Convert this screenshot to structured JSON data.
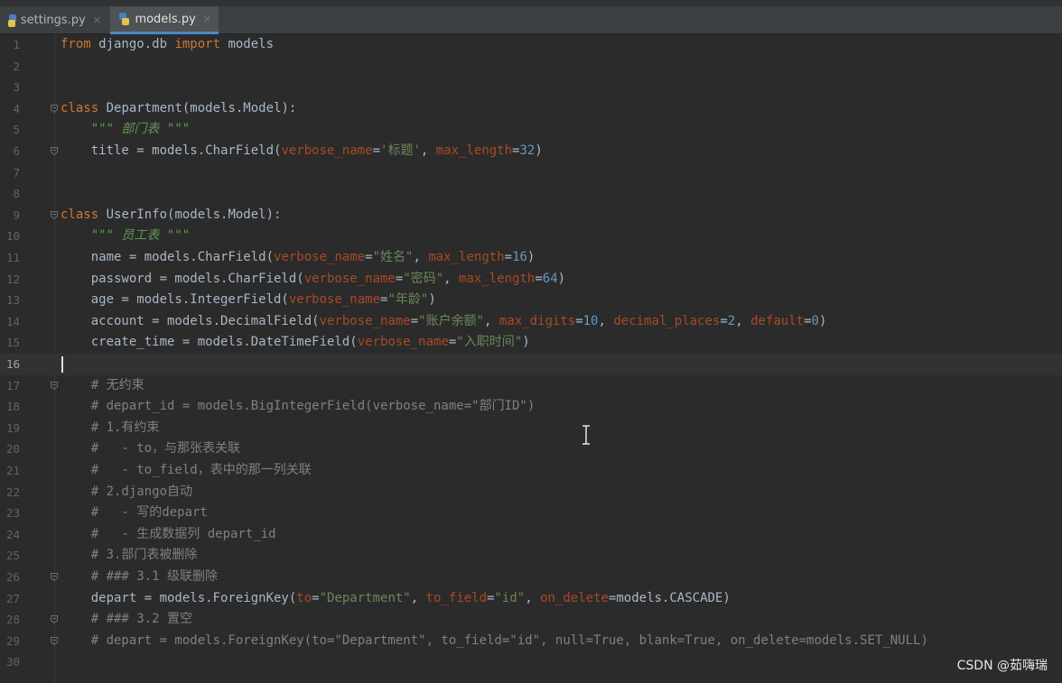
{
  "tabs": [
    {
      "label": "settings.py",
      "active": false
    },
    {
      "label": "models.py",
      "active": true
    }
  ],
  "editor": {
    "current_line": 16,
    "lines": [
      {
        "n": "1",
        "tokens": [
          [
            "kw",
            "from"
          ],
          [
            "t",
            " django.db "
          ],
          [
            "kw",
            "import"
          ],
          [
            "t",
            " models"
          ]
        ]
      },
      {
        "n": "2",
        "tokens": []
      },
      {
        "n": "3",
        "tokens": []
      },
      {
        "n": "4",
        "fold": true,
        "tokens": [
          [
            "kw",
            "class"
          ],
          [
            "t",
            " Department(models.Model):"
          ]
        ]
      },
      {
        "n": "5",
        "tokens": [
          [
            "t",
            "    "
          ],
          [
            "doc",
            "\"\"\" 部门表 \"\"\""
          ]
        ]
      },
      {
        "n": "6",
        "fold": true,
        "tokens": [
          [
            "t",
            "    title = models.CharField("
          ],
          [
            "prm",
            "verbose_name"
          ],
          [
            "t",
            "="
          ],
          [
            "str",
            "'标题'"
          ],
          [
            "t",
            ", "
          ],
          [
            "prm",
            "max_length"
          ],
          [
            "t",
            "="
          ],
          [
            "num",
            "32"
          ],
          [
            "t",
            ")"
          ]
        ]
      },
      {
        "n": "7",
        "tokens": []
      },
      {
        "n": "8",
        "tokens": []
      },
      {
        "n": "9",
        "fold": true,
        "tokens": [
          [
            "kw",
            "class"
          ],
          [
            "t",
            " UserInfo(models.Model):"
          ]
        ]
      },
      {
        "n": "10",
        "tokens": [
          [
            "t",
            "    "
          ],
          [
            "doc",
            "\"\"\" 员工表 \"\"\""
          ]
        ]
      },
      {
        "n": "11",
        "tokens": [
          [
            "t",
            "    name = models.CharField("
          ],
          [
            "prm",
            "verbose_name"
          ],
          [
            "t",
            "="
          ],
          [
            "str",
            "\"姓名\""
          ],
          [
            "t",
            ", "
          ],
          [
            "prm",
            "max_length"
          ],
          [
            "t",
            "="
          ],
          [
            "num",
            "16"
          ],
          [
            "t",
            ")"
          ]
        ]
      },
      {
        "n": "12",
        "tokens": [
          [
            "t",
            "    password = models.CharField("
          ],
          [
            "prm",
            "verbose_name"
          ],
          [
            "t",
            "="
          ],
          [
            "str",
            "\"密码\""
          ],
          [
            "t",
            ", "
          ],
          [
            "prm",
            "max_length"
          ],
          [
            "t",
            "="
          ],
          [
            "num",
            "64"
          ],
          [
            "t",
            ")"
          ]
        ]
      },
      {
        "n": "13",
        "tokens": [
          [
            "t",
            "    age = models.IntegerField("
          ],
          [
            "prm",
            "verbose_name"
          ],
          [
            "t",
            "="
          ],
          [
            "str",
            "\"年龄\""
          ],
          [
            "t",
            ")"
          ]
        ]
      },
      {
        "n": "14",
        "tokens": [
          [
            "t",
            "    account = models.DecimalField("
          ],
          [
            "prm",
            "verbose_name"
          ],
          [
            "t",
            "="
          ],
          [
            "str",
            "\"账户余额\""
          ],
          [
            "t",
            ", "
          ],
          [
            "prm",
            "max_digits"
          ],
          [
            "t",
            "="
          ],
          [
            "num",
            "10"
          ],
          [
            "t",
            ", "
          ],
          [
            "prm",
            "decimal_places"
          ],
          [
            "t",
            "="
          ],
          [
            "num",
            "2"
          ],
          [
            "t",
            ", "
          ],
          [
            "prm",
            "default"
          ],
          [
            "t",
            "="
          ],
          [
            "num",
            "0"
          ],
          [
            "t",
            ")"
          ]
        ]
      },
      {
        "n": "15",
        "tokens": [
          [
            "t",
            "    create_time = models.DateTimeField("
          ],
          [
            "prm",
            "verbose_name"
          ],
          [
            "t",
            "="
          ],
          [
            "str",
            "\"入职时间\""
          ],
          [
            "t",
            ")"
          ]
        ]
      },
      {
        "n": "16",
        "tokens": []
      },
      {
        "n": "17",
        "fold": true,
        "tokens": [
          [
            "cmt",
            "    # 无约束"
          ]
        ]
      },
      {
        "n": "18",
        "tokens": [
          [
            "cmt",
            "    # depart_id = models.BigIntegerField(verbose_name=\"部门ID\")"
          ]
        ]
      },
      {
        "n": "19",
        "tokens": [
          [
            "cmt",
            "    # 1.有约束"
          ]
        ]
      },
      {
        "n": "20",
        "tokens": [
          [
            "cmt",
            "    #   - to，与那张表关联"
          ]
        ]
      },
      {
        "n": "21",
        "tokens": [
          [
            "cmt",
            "    #   - to_field，表中的那一列关联"
          ]
        ]
      },
      {
        "n": "22",
        "tokens": [
          [
            "cmt",
            "    # 2.django自动"
          ]
        ]
      },
      {
        "n": "23",
        "tokens": [
          [
            "cmt",
            "    #   - 写的depart"
          ]
        ]
      },
      {
        "n": "24",
        "tokens": [
          [
            "cmt",
            "    #   - 生成数据列 depart_id"
          ]
        ]
      },
      {
        "n": "25",
        "tokens": [
          [
            "cmt",
            "    # 3.部门表被删除"
          ]
        ]
      },
      {
        "n": "26",
        "fold": true,
        "tokens": [
          [
            "cmt",
            "    # ### 3.1 级联删除"
          ]
        ]
      },
      {
        "n": "27",
        "tokens": [
          [
            "t",
            "    depart = models.ForeignKey("
          ],
          [
            "prm",
            "to"
          ],
          [
            "t",
            "="
          ],
          [
            "str",
            "\"Department\""
          ],
          [
            "t",
            ", "
          ],
          [
            "prm",
            "to_field"
          ],
          [
            "t",
            "="
          ],
          [
            "str",
            "\"id\""
          ],
          [
            "t",
            ", "
          ],
          [
            "prm",
            "on_delete"
          ],
          [
            "t",
            "=models.CASCADE)"
          ]
        ]
      },
      {
        "n": "28",
        "fold": true,
        "tokens": [
          [
            "cmt",
            "    # ### 3.2 置空"
          ]
        ]
      },
      {
        "n": "29",
        "fold": true,
        "tokens": [
          [
            "cmt",
            "    # depart = models.ForeignKey(to=\"Department\", to_field=\"id\", null=True, blank=True, on_delete=models.SET_NULL)"
          ]
        ]
      },
      {
        "n": "30",
        "tokens": []
      }
    ]
  },
  "watermark": "CSDN @茹嗨瑞",
  "icons": {
    "tab_file": "python-file-icon",
    "tab_close": "close-icon",
    "fold": "fold-marker-icon",
    "cursor": "text-cursor-icon"
  }
}
